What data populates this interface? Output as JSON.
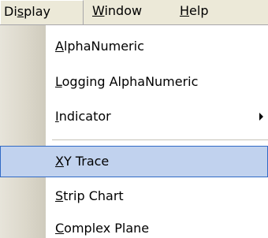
{
  "menubar": {
    "items": [
      {
        "pre": "Di",
        "acc": "s",
        "post": "play"
      },
      {
        "pre": "",
        "acc": "W",
        "post": "indow"
      },
      {
        "pre": "",
        "acc": "H",
        "post": "elp"
      }
    ]
  },
  "menu": {
    "items": [
      {
        "pre": "",
        "acc": "A",
        "post": "lphaNumeric"
      },
      {
        "pre": "",
        "acc": "L",
        "post": "ogging AlphaNumeric"
      },
      {
        "pre": "",
        "acc": "I",
        "post": "ndicator"
      },
      {
        "pre": "",
        "acc": "X",
        "post": "Y Trace"
      },
      {
        "pre": "",
        "acc": "S",
        "post": "trip Chart"
      },
      {
        "pre": "",
        "acc": "C",
        "post": "omplex Plane"
      }
    ]
  },
  "colors": {
    "highlight_fill": "#c1d2ee",
    "highlight_border": "#316ac5",
    "menubar_bg": "#ece9d8"
  }
}
